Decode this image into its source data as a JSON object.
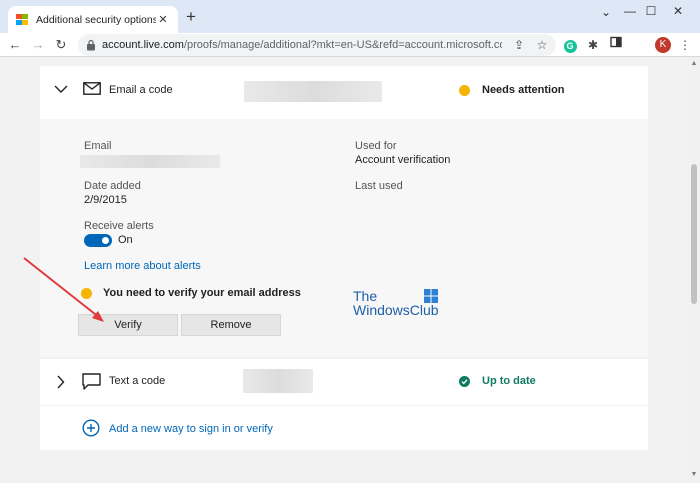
{
  "browser": {
    "tab_title": "Additional security options",
    "tab_close": "✕",
    "new_tab": "+",
    "window_controls": [
      "⌄",
      "—",
      "☐",
      "✕"
    ],
    "url_host": "account.live.com",
    "url_path": "/proofs/manage/additional?mkt=en-US&refd=account.microsoft.com&r...",
    "avatar_letter": "K",
    "ms_colors": [
      "#f25022",
      "#7fba00",
      "#00a4ef",
      "#ffb900"
    ]
  },
  "email_row": {
    "label": "Email a code",
    "status": "Needs attention",
    "status_color": "#f5b400"
  },
  "details": {
    "email_label": "Email",
    "used_for_label": "Used for",
    "used_for_value": "Account verification",
    "date_added_label": "Date added",
    "date_added_value": "2/9/2015",
    "last_used_label": "Last used",
    "receive_alerts_label": "Receive alerts",
    "toggle_state": "On",
    "learn_more_link": "Learn more about alerts",
    "warning_text": "You need to verify your email address",
    "verify_button": "Verify",
    "remove_button": "Remove"
  },
  "watermark": {
    "line1": "The",
    "line2": "WindowsClub"
  },
  "text_row": {
    "label": "Text a code",
    "status": "Up to date",
    "status_color": "#0f7b62"
  },
  "add_row": {
    "label": "Add a new way to sign in or verify"
  }
}
